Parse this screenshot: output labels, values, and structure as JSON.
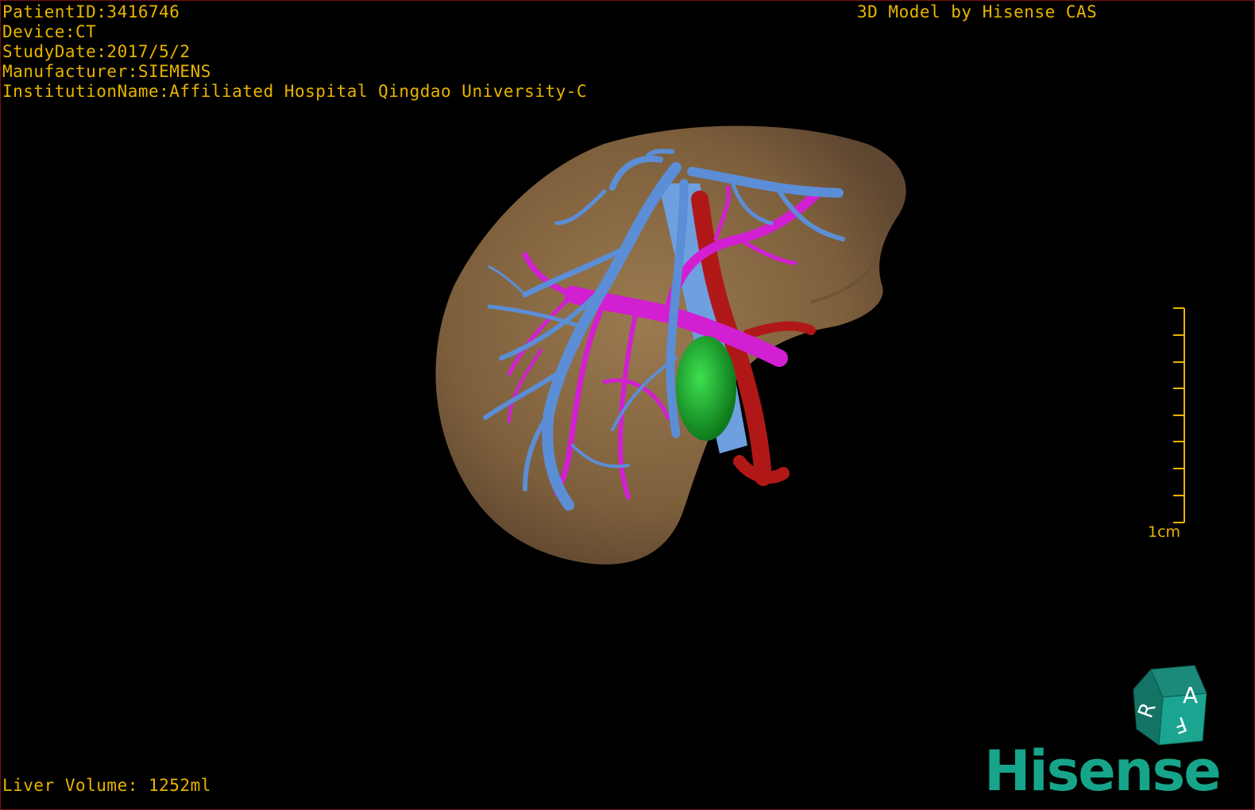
{
  "header": {
    "patient_id": "PatientID:3416746",
    "device": "Device:CT",
    "study_date": "StudyDate:2017/5/2",
    "manufacturer": "Manufacturer:SIEMENS",
    "institution": "InstitutionName:Affiliated Hospital Qingdao University-C",
    "model_credit": "3D Model by Hisense CAS"
  },
  "footer": {
    "liver_volume": "Liver Volume: 1252ml"
  },
  "scale": {
    "label": "1cm"
  },
  "orientation_cube": {
    "face_top": "A",
    "face_left": "R",
    "face_bottom": "F"
  },
  "brand": {
    "logo_text": "Hisense"
  },
  "colors": {
    "overlay_text": "#e8b400",
    "liver": "#8a6a45",
    "hepatic_vein": "#5b8ed6",
    "portal_vein": "#d21fd2",
    "artery": "#b01818",
    "tumor": "#1aa030",
    "ivc": "#6ea0e0",
    "logo": "#16a58a",
    "border": "#7a1010"
  }
}
